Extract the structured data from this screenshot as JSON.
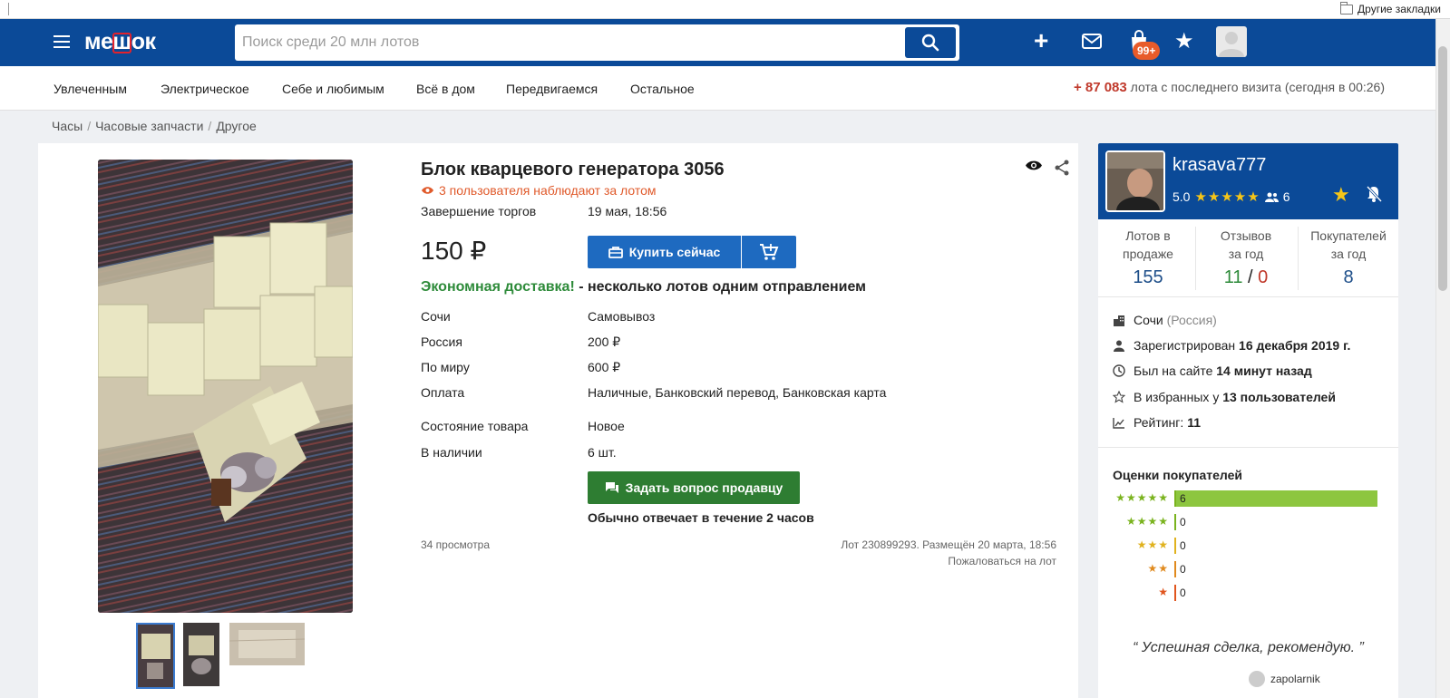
{
  "browser": {
    "other_bookmarks": "Другие закладки"
  },
  "header": {
    "logo": {
      "pre": "ме",
      "mid": "ш",
      "post": "ок"
    },
    "search_placeholder": "Поиск среди 20 млн лотов",
    "cart_badge": "99+",
    "accent": "#0b4a98"
  },
  "nav": {
    "items": [
      "Увлеченным",
      "Электрическое",
      "Себе и любимым",
      "Всё в дом",
      "Передвигаемся",
      "Остальное"
    ],
    "visit_count": "+ 87 083",
    "visit_text": " лота с последнего визита (сегодня в 00:26)"
  },
  "breadcrumb": [
    "Часы",
    "Часовые запчасти",
    "Другое"
  ],
  "lot": {
    "title": "Блок кварцевого генератора 3056",
    "watchers": "3 пользователя наблюдают за лотом",
    "end_label": "Завершение торгов",
    "end_value": "19 мая, 18:56",
    "price": "150 ₽",
    "buy_label": "Купить сейчас",
    "delivery_green": "Экономная доставка!",
    "delivery_rest": " - несколько лотов одним отправлением",
    "shipping": [
      {
        "label": "Сочи",
        "value": "Самовывоз"
      },
      {
        "label": "Россия",
        "value": "200 ₽"
      },
      {
        "label": "По миру",
        "value": "600 ₽"
      },
      {
        "label": "Оплата",
        "value": "Наличные, Банковский перевод, Банковская карта"
      }
    ],
    "condition_label": "Состояние товара",
    "condition_value": "Новое",
    "stock_label": "В наличии",
    "stock_value": "6 шт.",
    "ask_label": "Задать вопрос продавцу",
    "answer_time": "Обычно отвечает в течение 2 часов",
    "views": "34 просмотра",
    "lot_info": "Лот 230899293. Размещён 20 марта, 18:56",
    "report": "Пожаловаться на лот"
  },
  "seller": {
    "name": "krasava777",
    "rating": "5.0",
    "rating_stars": "★★★★★",
    "followers": "6",
    "stats": [
      {
        "label1": "Лотов в",
        "label2": "продаже",
        "value": "155"
      },
      {
        "label1": "Отзывов",
        "label2": "за год",
        "positive": "11",
        "divider": "/",
        "negative": "0"
      },
      {
        "label1": "Покупателей",
        "label2": "за год",
        "value": "8"
      }
    ],
    "city": "Сочи",
    "country": "(Россия)",
    "registered_label": "Зарегистрирован ",
    "registered_value": "16 декабря 2019 г.",
    "seen_label": "Был на сайте ",
    "seen_value": "14 минут назад",
    "fav_label": "В избранных у ",
    "fav_value": "13 пользователей",
    "rating_label": "Рейтинг: ",
    "rating_value": "11",
    "ratings_title": "Оценки покупателей",
    "ratings": [
      {
        "stars": "★★★★★",
        "count": "6",
        "share": 1.0,
        "color": "#7ab31e"
      },
      {
        "stars": "★★★★",
        "count": "0",
        "share": 0,
        "color": "#7ab31e"
      },
      {
        "stars": "★★★",
        "count": "0",
        "share": 0,
        "color": "#e0b21e"
      },
      {
        "stars": "★★",
        "count": "0",
        "share": 0,
        "color": "#e08a1e"
      },
      {
        "stars": "★",
        "count": "0",
        "share": 0,
        "color": "#e0551e"
      }
    ],
    "review_text": "“ Успешная сделка, рекомендую. ”",
    "reviewer": "zapolarnik"
  }
}
